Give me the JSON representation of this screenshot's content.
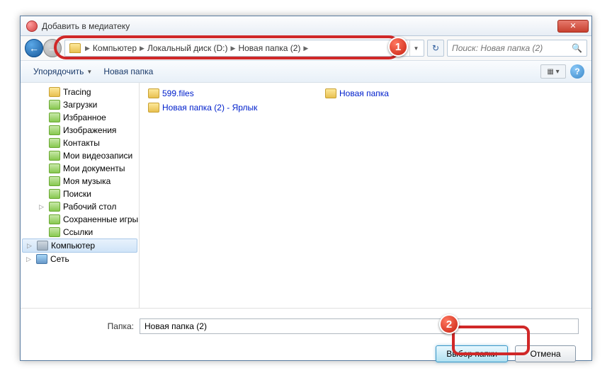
{
  "window": {
    "title": "Добавить в медиатеку"
  },
  "breadcrumb": {
    "items": [
      "Компьютер",
      "Локальный диск (D:)",
      "Новая папка (2)"
    ]
  },
  "search": {
    "placeholder": "Поиск: Новая папка (2)"
  },
  "toolbar": {
    "organize": "Упорядочить",
    "newfolder": "Новая папка"
  },
  "sidebar": {
    "items": [
      {
        "label": "Tracing",
        "icon": "folder",
        "lvl": 2
      },
      {
        "label": "Загрузки",
        "icon": "special",
        "lvl": 2
      },
      {
        "label": "Избранное",
        "icon": "special",
        "lvl": 2
      },
      {
        "label": "Изображения",
        "icon": "special",
        "lvl": 2
      },
      {
        "label": "Контакты",
        "icon": "special",
        "lvl": 2
      },
      {
        "label": "Мои видеозаписи",
        "icon": "special",
        "lvl": 2
      },
      {
        "label": "Мои документы",
        "icon": "special",
        "lvl": 2
      },
      {
        "label": "Моя музыка",
        "icon": "special",
        "lvl": 2
      },
      {
        "label": "Поиски",
        "icon": "special",
        "lvl": 2
      },
      {
        "label": "Рабочий стол",
        "icon": "special",
        "lvl": 2,
        "exp": true
      },
      {
        "label": "Сохраненные игры",
        "icon": "special",
        "lvl": 2
      },
      {
        "label": "Ссылки",
        "icon": "special",
        "lvl": 2
      },
      {
        "label": "Компьютер",
        "icon": "computer",
        "lvl": 1,
        "sel": true,
        "exp": true
      },
      {
        "label": "Сеть",
        "icon": "network",
        "lvl": 1,
        "exp": true
      }
    ]
  },
  "files": {
    "items": [
      {
        "label": "599.files",
        "icon": "folder"
      },
      {
        "label": "Новая папка",
        "icon": "folder"
      },
      {
        "label": "Новая папка (2) - Ярлык",
        "icon": "shortcut"
      }
    ]
  },
  "footer": {
    "folder_label": "Папка:",
    "folder_value": "Новая папка (2)",
    "select_btn": "Выбор папки",
    "cancel_btn": "Отмена"
  },
  "badges": {
    "b1": "1",
    "b2": "2"
  }
}
